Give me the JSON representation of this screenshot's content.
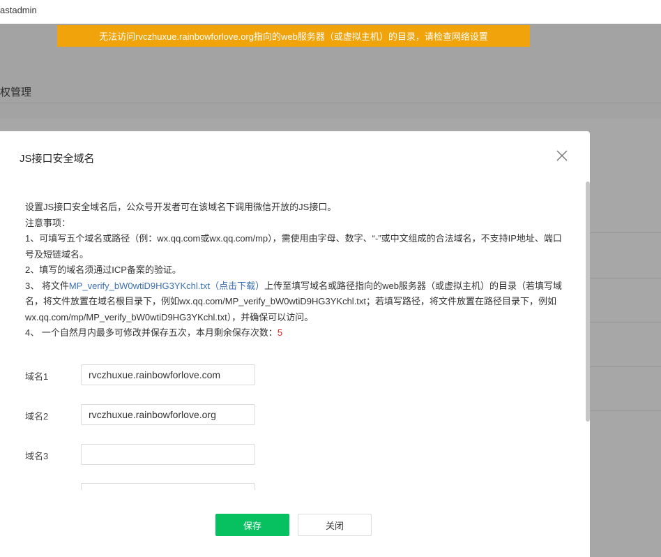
{
  "app": {
    "brand": "astadmin"
  },
  "banner": {
    "warning": "无法访问rvczhuxue.rainbowforlove.org指向的web服务器（或虚拟主机）的目录，请检查网络设置"
  },
  "background": {
    "section_title": "权管理"
  },
  "modal": {
    "title": "JS接口安全域名",
    "intro": "设置JS接口安全域名后，公众号开发者可在该域名下调用微信开放的JS接口。",
    "notice_heading": "注意事项：",
    "notes": {
      "n1": "1、可填写五个域名或路径（例：wx.qq.com或wx.qq.com/mp），需使用由字母、数字、“-”或中文组成的合法域名，不支持IP地址、端口号及短链域名。",
      "n2": "2、填写的域名须通过ICP备案的验证。",
      "n3_prefix": "3、 将文件",
      "n3_link": "MP_verify_bW0wtiD9HG3YKchl.txt（点击下载）",
      "n3_suffix": "上传至填写域名或路径指向的web服务器（或虚拟主机）的目录（若填写域名，将文件放置在域名根目录下，例如wx.qq.com/MP_verify_bW0wtiD9HG3YKchl.txt；若填写路径，将文件放置在路径目录下，例如wx.qq.com/mp/MP_verify_bW0wtiD9HG3YKchl.txt），并确保可以访问。",
      "n4_prefix": "4、 一个自然月内最多可修改并保存五次，本月剩余保存次数：",
      "n4_count": "5"
    },
    "fields": [
      {
        "label": "域名1",
        "value": "rvczhuxue.rainbowforlove.com"
      },
      {
        "label": "域名2",
        "value": "rvczhuxue.rainbowforlove.org"
      },
      {
        "label": "域名3",
        "value": ""
      }
    ],
    "buttons": {
      "save": "保存",
      "close": "关闭"
    }
  },
  "colors": {
    "accent": "#07c160",
    "warning": "#f0a30a",
    "link": "#3a6fb4",
    "count": "#e02020"
  }
}
